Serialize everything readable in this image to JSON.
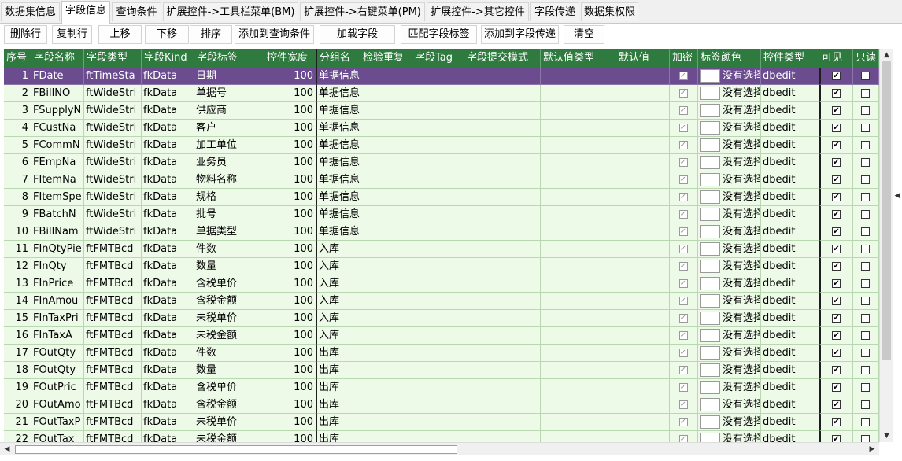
{
  "tabs": [
    {
      "label": "数据集信息",
      "active": false
    },
    {
      "label": "字段信息",
      "active": true
    },
    {
      "label": "查询条件",
      "active": false
    },
    {
      "label": "扩展控件->工具栏菜单(BM)",
      "active": false
    },
    {
      "label": "扩展控件->右键菜单(PM)",
      "active": false
    },
    {
      "label": "扩展控件->其它控件",
      "active": false
    },
    {
      "label": "字段传递",
      "active": false
    },
    {
      "label": "数据集权限",
      "active": false
    }
  ],
  "toolbar": [
    "删除行",
    "复制行",
    "上移",
    "下移",
    "排序",
    "添加到查询条件",
    "加载字段",
    "匹配字段标签",
    "添加到字段传递",
    "清空"
  ],
  "columns": [
    "序号",
    "字段名称",
    "字段类型",
    "字段Kind",
    "字段标签",
    "控件宽度",
    "分组名",
    "检验重复",
    "字段Tag",
    "字段提交模式",
    "默认值类型",
    "默认值",
    "加密",
    "标签颜色",
    "控件类型",
    "可见",
    "只读"
  ],
  "color_text": "没有选择",
  "rows": [
    {
      "no": "1",
      "name": "FDate",
      "type": "ftTimeSta",
      "kind": "fkData",
      "label": "日期",
      "width": "100",
      "group": "单据信息",
      "ctrl": "dbedit",
      "visible": true,
      "readonly": false,
      "selected": true
    },
    {
      "no": "2",
      "name": "FBillNO",
      "type": "ftWideStri",
      "kind": "fkData",
      "label": "单据号",
      "width": "100",
      "group": "单据信息",
      "ctrl": "dbedit",
      "visible": true,
      "readonly": false
    },
    {
      "no": "3",
      "name": "FSupplyN",
      "type": "ftWideStri",
      "kind": "fkData",
      "label": "供应商",
      "width": "100",
      "group": "单据信息",
      "ctrl": "dbedit",
      "visible": true,
      "readonly": false
    },
    {
      "no": "4",
      "name": "FCustNa",
      "type": "ftWideStri",
      "kind": "fkData",
      "label": "客户",
      "width": "100",
      "group": "单据信息",
      "ctrl": "dbedit",
      "visible": true,
      "readonly": false
    },
    {
      "no": "5",
      "name": "FCommN",
      "type": "ftWideStri",
      "kind": "fkData",
      "label": "加工单位",
      "width": "100",
      "group": "单据信息",
      "ctrl": "dbedit",
      "visible": true,
      "readonly": false
    },
    {
      "no": "6",
      "name": "FEmpNa",
      "type": "ftWideStri",
      "kind": "fkData",
      "label": "业务员",
      "width": "100",
      "group": "单据信息",
      "ctrl": "dbedit",
      "visible": true,
      "readonly": false
    },
    {
      "no": "7",
      "name": "FItemNa",
      "type": "ftWideStri",
      "kind": "fkData",
      "label": "物料名称",
      "width": "100",
      "group": "单据信息",
      "ctrl": "dbedit",
      "visible": true,
      "readonly": false
    },
    {
      "no": "8",
      "name": "FItemSpe",
      "type": "ftWideStri",
      "kind": "fkData",
      "label": "规格",
      "width": "100",
      "group": "单据信息",
      "ctrl": "dbedit",
      "visible": true,
      "readonly": false
    },
    {
      "no": "9",
      "name": "FBatchN",
      "type": "ftWideStri",
      "kind": "fkData",
      "label": "批号",
      "width": "100",
      "group": "单据信息",
      "ctrl": "dbedit",
      "visible": true,
      "readonly": false
    },
    {
      "no": "10",
      "name": "FBillNam",
      "type": "ftWideStri",
      "kind": "fkData",
      "label": "单据类型",
      "width": "100",
      "group": "单据信息",
      "ctrl": "dbedit",
      "visible": true,
      "readonly": false
    },
    {
      "no": "11",
      "name": "FInQtyPie",
      "type": "ftFMTBcd",
      "kind": "fkData",
      "label": "件数",
      "width": "100",
      "group": "入库",
      "ctrl": "dbedit",
      "visible": true,
      "readonly": false
    },
    {
      "no": "12",
      "name": "FInQty",
      "type": "ftFMTBcd",
      "kind": "fkData",
      "label": "数量",
      "width": "100",
      "group": "入库",
      "ctrl": "dbedit",
      "visible": true,
      "readonly": false
    },
    {
      "no": "13",
      "name": "FInPrice",
      "type": "ftFMTBcd",
      "kind": "fkData",
      "label": "含税单价",
      "width": "100",
      "group": "入库",
      "ctrl": "dbedit",
      "visible": true,
      "readonly": false
    },
    {
      "no": "14",
      "name": "FInAmou",
      "type": "ftFMTBcd",
      "kind": "fkData",
      "label": "含税金额",
      "width": "100",
      "group": "入库",
      "ctrl": "dbedit",
      "visible": true,
      "readonly": false
    },
    {
      "no": "15",
      "name": "FInTaxPri",
      "type": "ftFMTBcd",
      "kind": "fkData",
      "label": "未税单价",
      "width": "100",
      "group": "入库",
      "ctrl": "dbedit",
      "visible": true,
      "readonly": false
    },
    {
      "no": "16",
      "name": "FInTaxA",
      "type": "ftFMTBcd",
      "kind": "fkData",
      "label": "未税金额",
      "width": "100",
      "group": "入库",
      "ctrl": "dbedit",
      "visible": true,
      "readonly": false
    },
    {
      "no": "17",
      "name": "FOutQty",
      "type": "ftFMTBcd",
      "kind": "fkData",
      "label": "件数",
      "width": "100",
      "group": "出库",
      "ctrl": "dbedit",
      "visible": true,
      "readonly": false
    },
    {
      "no": "18",
      "name": "FOutQty",
      "type": "ftFMTBcd",
      "kind": "fkData",
      "label": "数量",
      "width": "100",
      "group": "出库",
      "ctrl": "dbedit",
      "visible": true,
      "readonly": false
    },
    {
      "no": "19",
      "name": "FOutPric",
      "type": "ftFMTBcd",
      "kind": "fkData",
      "label": "含税单价",
      "width": "100",
      "group": "出库",
      "ctrl": "dbedit",
      "visible": true,
      "readonly": false
    },
    {
      "no": "20",
      "name": "FOutAmo",
      "type": "ftFMTBcd",
      "kind": "fkData",
      "label": "含税金额",
      "width": "100",
      "group": "出库",
      "ctrl": "dbedit",
      "visible": true,
      "readonly": false
    },
    {
      "no": "21",
      "name": "FOutTaxP",
      "type": "ftFMTBcd",
      "kind": "fkData",
      "label": "未税单价",
      "width": "100",
      "group": "出库",
      "ctrl": "dbedit",
      "visible": true,
      "readonly": false
    },
    {
      "no": "22",
      "name": "FOutTax",
      "type": "ftFMTBcd",
      "kind": "fkData",
      "label": "未税金额",
      "width": "100",
      "group": "出库",
      "ctrl": "dbedit",
      "visible": true,
      "readonly": false
    }
  ],
  "colors": {
    "header_bg": "#2f7a3e",
    "row_bg": "#eefae8",
    "selected_bg": "#6b4c8e"
  },
  "icons": {
    "scroll_up": "triangle-up-icon",
    "scroll_down": "triangle-down-icon",
    "scroll_left": "triangle-left-icon",
    "scroll_right": "triangle-right-icon",
    "panel_collapse": "chevron-left-icon"
  }
}
